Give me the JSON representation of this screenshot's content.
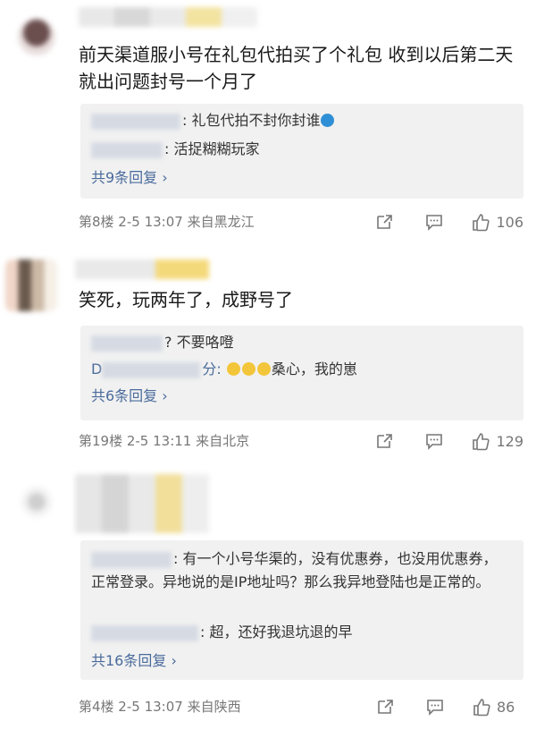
{
  "comments": [
    {
      "text": "前天渠道服小号在礼包代拍买了个礼包 收到以后第二天就出问题封号一个月了",
      "replies": [
        {
          "tail": ": 礼包代拍不封你封谁"
        },
        {
          "tail": ": 活捉糊糊玩家"
        }
      ],
      "reply_count": "共9条回复 ›",
      "meta": "第8楼  2-5 13:07  来自黑龙江",
      "likes": "106"
    },
    {
      "text": "笑死，玩两年了，成野号了",
      "replies": [
        {
          "tail": "? 不要咯噔"
        },
        {
          "prefix": "D",
          "tail": "分: ",
          "tail2": "桑心，我的崽"
        }
      ],
      "reply_count": "共6条回复 ›",
      "meta": "第19楼  2-5 13:11  来自北京",
      "likes": "129"
    },
    {
      "text": "",
      "replies": [
        {
          "tail": ": 有一个小号华渠的，没有优惠券，也没用优惠券，正常登录。异地说的是IP地址吗？那么我异地登陆也是正常的。"
        },
        {
          "tail": ": 超，还好我退坑退的早"
        }
      ],
      "reply_count": "共16条回复 ›",
      "meta": "第4楼  2-5 13:07  来自陕西",
      "likes": "86"
    }
  ],
  "icons": [
    "share-icon",
    "comment-icon",
    "like-icon"
  ],
  "colors": {
    "link": "#4a6b9c",
    "reply_bg": "#f1f1f1",
    "meta": "#777777"
  }
}
